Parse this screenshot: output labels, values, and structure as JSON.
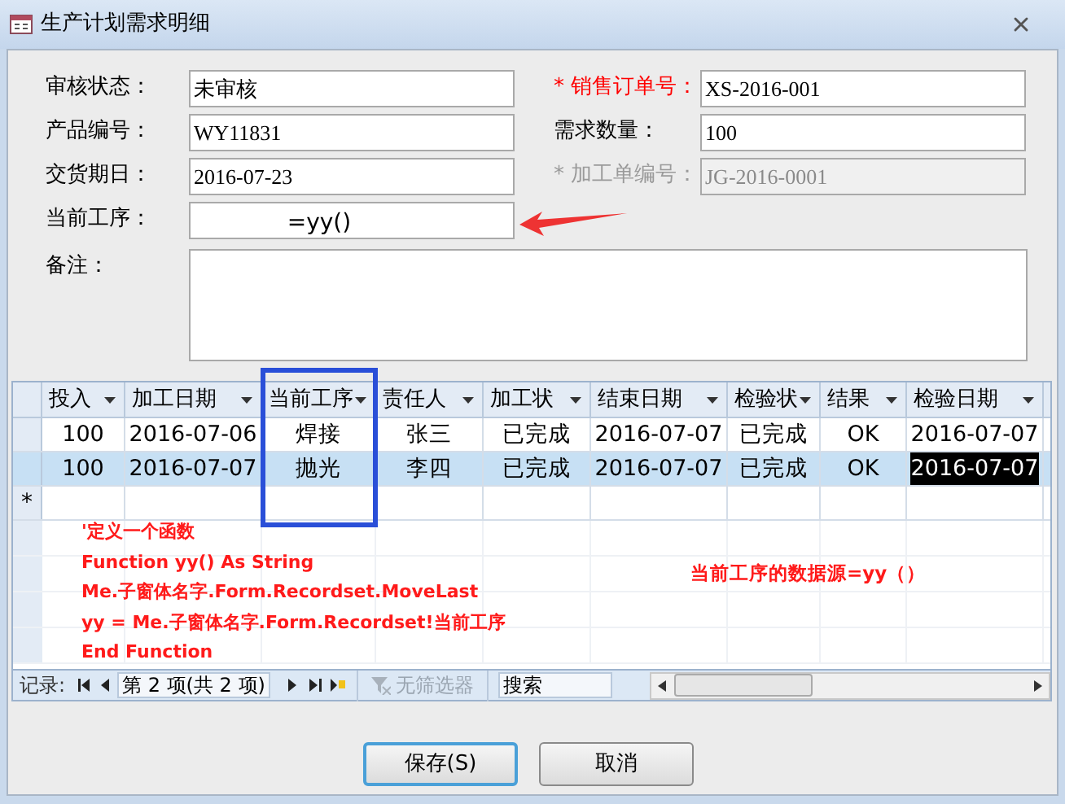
{
  "window": {
    "title": "生产计划需求明细"
  },
  "fields": [
    {
      "label": "审核状态：",
      "value": "未审核",
      "required": false,
      "disabled": false
    },
    {
      "label": "* 销售订单号：",
      "value": "XS-2016-001",
      "required": true,
      "disabled": false
    },
    {
      "label": "产品编号：",
      "value": "WY11831",
      "required": false,
      "disabled": false
    },
    {
      "label": "需求数量：",
      "value": "100",
      "required": false,
      "disabled": false
    },
    {
      "label": "交货期日：",
      "value": "2016-07-23",
      "required": false,
      "disabled": false
    },
    {
      "label": "* 加工单编号：",
      "value": "JG-2016-0001",
      "required": false,
      "disabled": true
    },
    {
      "label": "当前工序：",
      "value": "=yy()",
      "required": false,
      "disabled": false
    }
  ],
  "notes": {
    "label": "备注："
  },
  "table": {
    "columns": [
      "投入",
      "加工日期",
      "当前工序",
      "责任人",
      "加工状",
      "结束日期",
      "检验状",
      "结果",
      "检验日期"
    ],
    "rows": [
      {
        "selected": false,
        "cells": [
          {
            "text": "100",
            "focused": false
          },
          {
            "text": "2016-07-06",
            "focused": false
          },
          {
            "text": "焊接",
            "focused": false
          },
          {
            "text": "张三",
            "focused": false
          },
          {
            "text": "已完成",
            "focused": false
          },
          {
            "text": "2016-07-07",
            "focused": false
          },
          {
            "text": "已完成",
            "focused": false
          },
          {
            "text": "OK",
            "focused": false
          },
          {
            "text": "2016-07-07",
            "focused": false
          }
        ]
      },
      {
        "selected": true,
        "cells": [
          {
            "text": "100",
            "focused": false
          },
          {
            "text": "2016-07-07",
            "focused": false
          },
          {
            "text": "抛光",
            "focused": false
          },
          {
            "text": "李四",
            "focused": false
          },
          {
            "text": "已完成",
            "focused": false
          },
          {
            "text": "2016-07-07",
            "focused": false
          },
          {
            "text": "已完成",
            "focused": false
          },
          {
            "text": "OK",
            "focused": false
          },
          {
            "text": "2016-07-07",
            "focused": true
          }
        ]
      }
    ],
    "new_row_marker": "*"
  },
  "navigator": {
    "label": "记录:",
    "position": "第 2 项(共 2 项)",
    "filter": "无筛选器",
    "search": "搜索"
  },
  "annotations": {
    "code": [
      "'定义一个函数",
      "Function yy() As String",
      "Me.子窗体名字.Form.Recordset.MoveLast",
      "yy = Me.子窗体名字.Form.Recordset!当前工序",
      "End Function"
    ],
    "note": "当前工序的数据源=yy（）"
  },
  "buttons": [
    {
      "label": "保存(S)",
      "default": true
    },
    {
      "label": "取消",
      "default": false
    }
  ]
}
